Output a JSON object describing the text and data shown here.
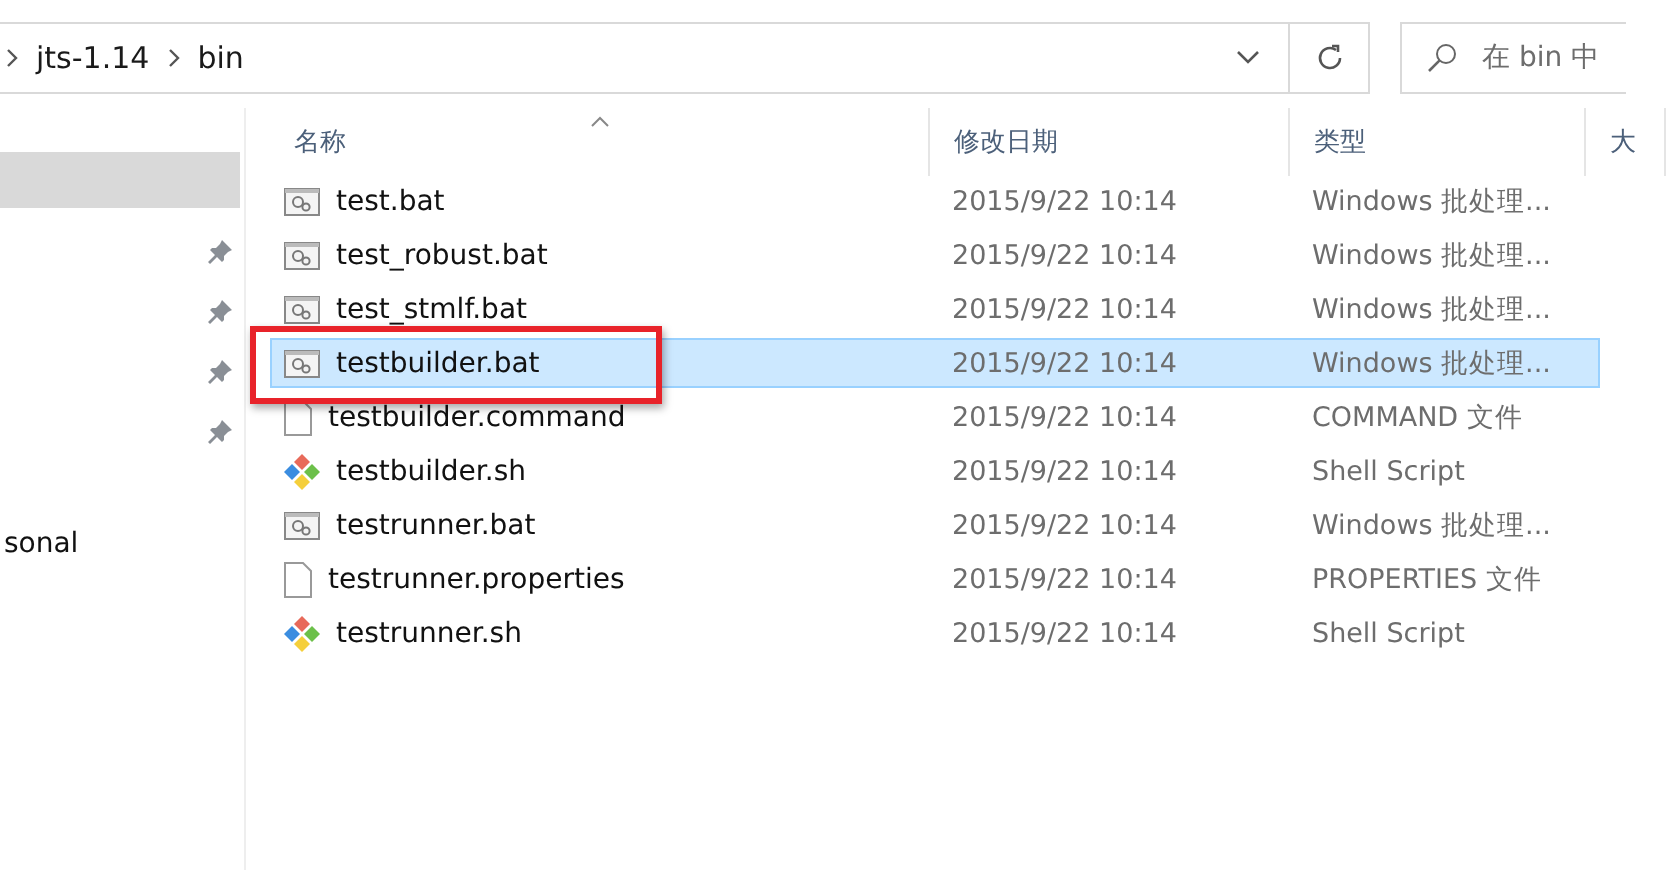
{
  "address_bar": {
    "breadcrumbs": [
      "jts-1.14",
      "bin"
    ]
  },
  "search": {
    "placeholder": "在 bin 中"
  },
  "sidebar": {
    "items": [
      {
        "selected": true,
        "pinned": false
      },
      {
        "selected": false,
        "pinned": true
      },
      {
        "selected": false,
        "pinned": true
      },
      {
        "selected": false,
        "pinned": true
      },
      {
        "selected": false,
        "pinned": true
      },
      {
        "label": "sonal",
        "selected": false,
        "pinned": false
      }
    ]
  },
  "table": {
    "columns": [
      "名称",
      "修改日期",
      "类型",
      "大"
    ],
    "rows": [
      {
        "kind": "bat",
        "name": "test.bat",
        "date": "2015/9/22 10:14",
        "type": "Windows 批处理...",
        "selected": false,
        "annotated": false
      },
      {
        "kind": "bat",
        "name": "test_robust.bat",
        "date": "2015/9/22 10:14",
        "type": "Windows 批处理...",
        "selected": false,
        "annotated": false
      },
      {
        "kind": "bat",
        "name": "test_stmlf.bat",
        "date": "2015/9/22 10:14",
        "type": "Windows 批处理...",
        "selected": false,
        "annotated": false
      },
      {
        "kind": "bat",
        "name": "testbuilder.bat",
        "date": "2015/9/22 10:14",
        "type": "Windows 批处理...",
        "selected": true,
        "annotated": true
      },
      {
        "kind": "file",
        "name": "testbuilder.command",
        "date": "2015/9/22 10:14",
        "type": "COMMAND 文件",
        "selected": false,
        "annotated": false
      },
      {
        "kind": "script",
        "name": "testbuilder.sh",
        "date": "2015/9/22 10:14",
        "type": "Shell Script",
        "selected": false,
        "annotated": false
      },
      {
        "kind": "bat",
        "name": "testrunner.bat",
        "date": "2015/9/22 10:14",
        "type": "Windows 批处理...",
        "selected": false,
        "annotated": false
      },
      {
        "kind": "file",
        "name": "testrunner.properties",
        "date": "2015/9/22 10:14",
        "type": "PROPERTIES 文件",
        "selected": false,
        "annotated": false
      },
      {
        "kind": "script",
        "name": "testrunner.sh",
        "date": "2015/9/22 10:14",
        "type": "Shell Script",
        "selected": false,
        "annotated": false
      }
    ]
  }
}
